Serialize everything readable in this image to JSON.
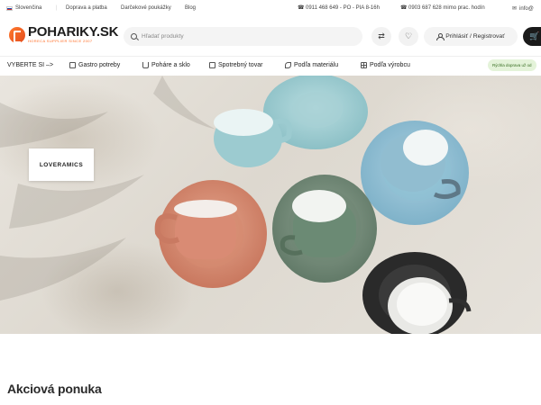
{
  "topbar": {
    "language": "Slovenčina",
    "links": [
      "Doprava a platba",
      "Darčekové poukážky",
      "Blog"
    ],
    "phone1": "0911 468 649 - PO - PIA 8-16h",
    "phone2": "0903 687 628 mimo prac. hodín",
    "email": "info@"
  },
  "header": {
    "logo_name": "POHARIKY.SK",
    "logo_sub": "HORECA SUPPLIER SINCE 2007",
    "search_placeholder": "Hľadať produkty",
    "login_label": "Prihlásiť / Registrovať",
    "icons": [
      "compare-icon",
      "heart-icon",
      "user-icon",
      "cart-icon"
    ]
  },
  "nav": {
    "select_label": "VYBERTE SI –>",
    "items": [
      "Gastro potreby",
      "Poháre a sklo",
      "Spotrebný tovar",
      "Podľa materiálu",
      "Podľa výrobcu"
    ],
    "shipping_badge": "Rýchla doprava už od"
  },
  "hero": {
    "brand": "LOVERAMICS"
  },
  "section": {
    "title": "Akciová ponuka"
  },
  "colors": {
    "accent": "#ff6a21",
    "dark": "#1a1a1a",
    "badge_bg": "#e4f3d9"
  }
}
